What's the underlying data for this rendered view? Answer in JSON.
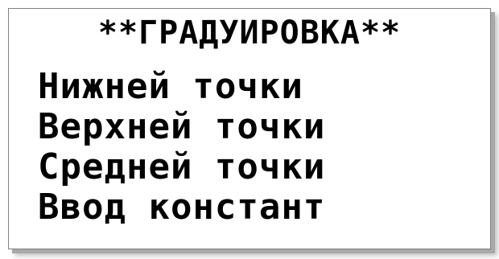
{
  "screen": {
    "title": "**ГРАДУИРОВКА**",
    "menu_items": [
      "Нижней точки",
      "Верхней точки",
      "Средней точки",
      "Ввод констант"
    ]
  }
}
